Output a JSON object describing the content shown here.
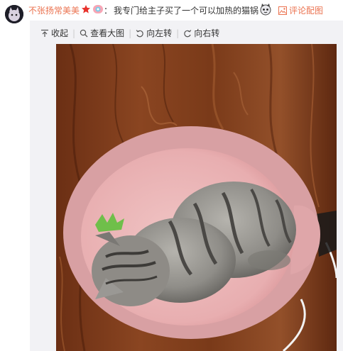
{
  "comment": {
    "username": "不张扬常美美",
    "separator": "：",
    "text": "我专门给主子买了一个可以加热的猫锅",
    "image_link_label": "评论配图",
    "badge_icon": "star-badge-icon",
    "emoji_icon": "cat-emoji-icon"
  },
  "toolbar": {
    "collapse_label": "收起",
    "view_large_label": "查看大图",
    "rotate_left_label": "向左转",
    "rotate_right_label": "向右转"
  },
  "colors": {
    "username": "#eb7350",
    "link": "#eb7350",
    "panel_bg": "#f2f2f5",
    "text": "#333333"
  }
}
